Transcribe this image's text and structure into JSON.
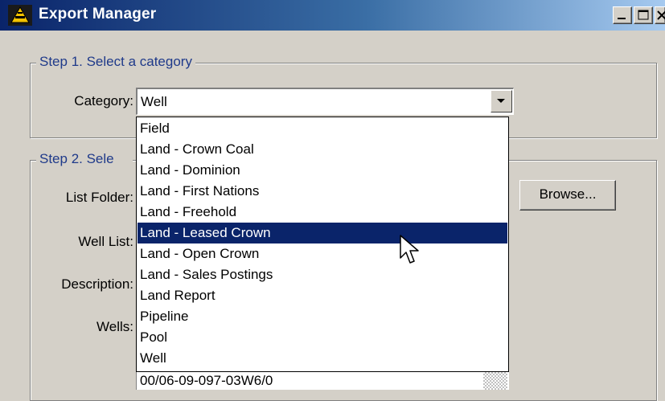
{
  "window": {
    "title": "Export Manager",
    "icon": "app-logo-icon",
    "controls": [
      "minimize-icon",
      "maximize-icon",
      "close-icon"
    ]
  },
  "step1": {
    "legend": "Step 1.  Select a category",
    "category_label": "Category:",
    "category_value": "Well"
  },
  "step2": {
    "legend": "Step 2.  Sele",
    "list_folder_label": "List Folder:",
    "well_list_label": "Well List:",
    "description_label": "Description:",
    "wells_label": "Wells:",
    "browse_label": "Browse...",
    "wells_first_row": "00/06-09-097-03W6/0"
  },
  "dropdown": {
    "items": [
      "Field",
      "Land - Crown Coal",
      "Land - Dominion",
      "Land - First Nations",
      "Land - Freehold",
      "Land - Leased Crown",
      "Land - Open Crown",
      "Land - Sales Postings",
      "Land Report",
      "Pipeline",
      "Pool",
      "Well"
    ],
    "selected_index": 5,
    "highlight_color": "#0a246a"
  },
  "cursor": {
    "icon": "arrow-cursor-icon"
  }
}
